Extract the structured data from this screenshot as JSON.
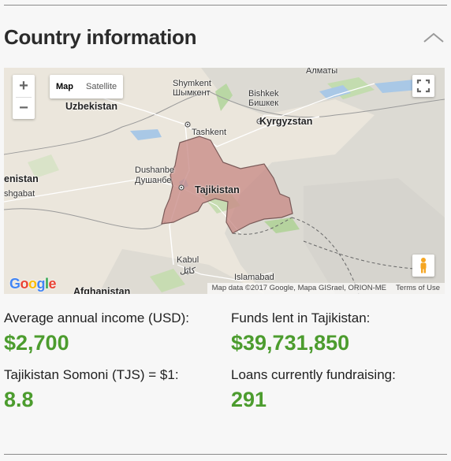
{
  "section": {
    "title": "Country information"
  },
  "map": {
    "zoom_in": "+",
    "zoom_out": "−",
    "type_map": "Map",
    "type_satellite": "Satellite",
    "google": [
      "G",
      "o",
      "o",
      "g",
      "l",
      "e"
    ],
    "google_colors": [
      "#4285F4",
      "#EA4335",
      "#FBBC05",
      "#4285F4",
      "#34A853",
      "#EA4335"
    ],
    "attribution": "Map data ©2017 Google, Mapa GISrael, ORION-ME",
    "terms": "Terms of Use",
    "highlight_color": "#c88a86",
    "labels": {
      "almaty": "Алматы",
      "shymkent_en": "Shymkent",
      "shymkent_ru": "Шымкент",
      "bishkek_en": "Bishkek",
      "bishkek_ru": "Бишкек",
      "uzbekistan": "Uzbekistan",
      "kyrgyzstan": "Kyrgyzstan",
      "tashkent": "Tashkent",
      "turkmenistan": "enistan",
      "ashgabat": "shgabat",
      "dushanbe_en": "Dushanbe",
      "dushanbe_ru": "Душанбе",
      "tajikistan": "Tajikistan",
      "kabul_en": "Kabul",
      "kabul_ps": "کابل",
      "islamabad": "Islamabad",
      "afghanistan": "Afghanistan"
    }
  },
  "stats": {
    "income_label": "Average annual income (USD):",
    "income_value": "$2,700",
    "funds_label": "Funds lent in Tajikistan:",
    "funds_value": "$39,731,850",
    "currency_label": "Tajikistan Somoni (TJS) = $1:",
    "currency_value": "8.8",
    "loans_label": "Loans currently fundraising:",
    "loans_value": "291"
  }
}
